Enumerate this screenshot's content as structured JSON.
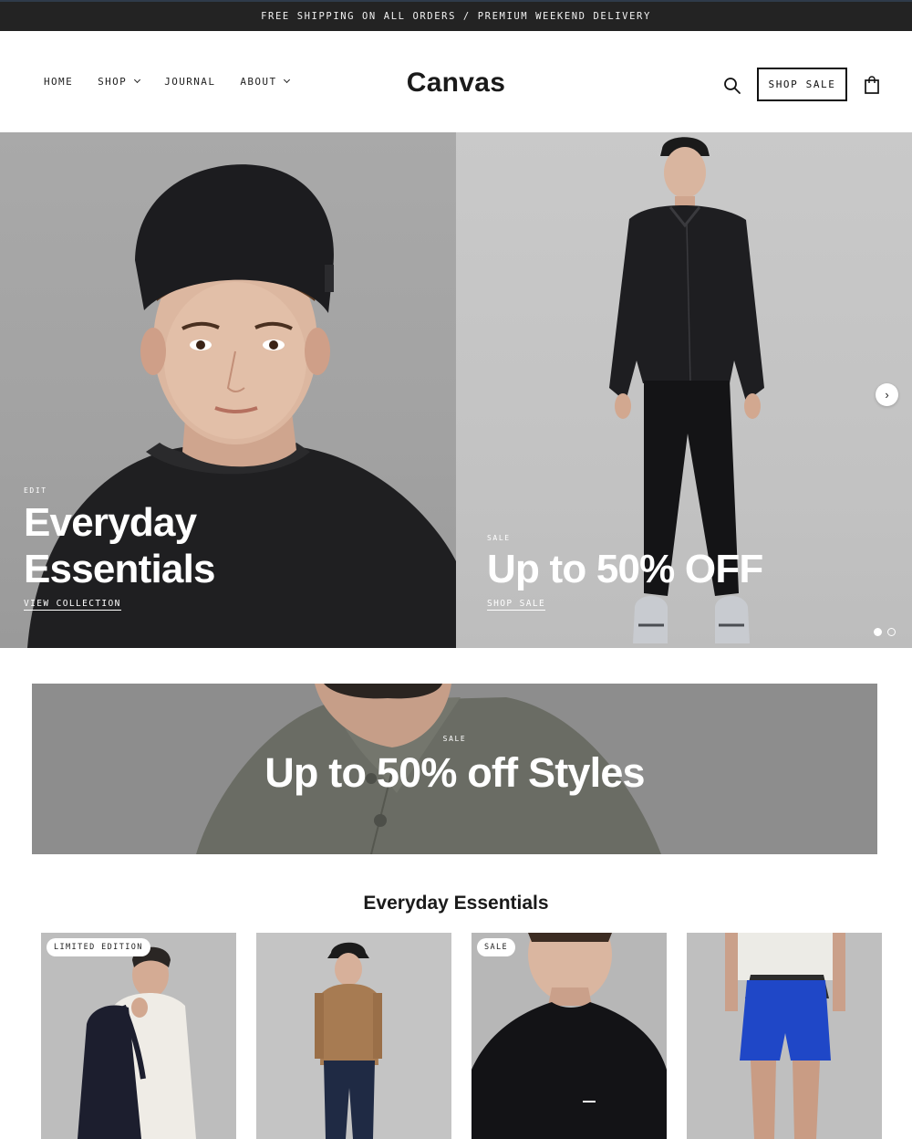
{
  "announcement": "FREE SHIPPING ON ALL ORDERS / PREMIUM WEEKEND DELIVERY",
  "nav": {
    "items": [
      {
        "label": "HOME"
      },
      {
        "label": "SHOP"
      },
      {
        "label": "JOURNAL"
      },
      {
        "label": "ABOUT"
      }
    ]
  },
  "brand": {
    "logo": "Canvas"
  },
  "header": {
    "sale_button": "SHOP SALE",
    "icons": [
      "search-icon",
      "shopping-bag-icon"
    ]
  },
  "hero": {
    "slides": [
      {
        "eyebrow": "EDIT",
        "title_line1": "Everyday",
        "title_line2": "Essentials",
        "link": "VIEW COLLECTION"
      },
      {
        "eyebrow": "SALE",
        "title": "Up to 50% OFF",
        "link": "SHOP SALE"
      }
    ],
    "next_icon": "›",
    "pagination": {
      "total": 2,
      "active": 1
    }
  },
  "banner": {
    "eyebrow": "SALE",
    "title": "Up to 50% off Styles"
  },
  "products": {
    "title": "Everyday Essentials",
    "items": [
      {
        "badge": "LIMITED EDITION"
      },
      {
        "badge": ""
      },
      {
        "badge": "SALE"
      },
      {
        "badge": ""
      }
    ]
  }
}
